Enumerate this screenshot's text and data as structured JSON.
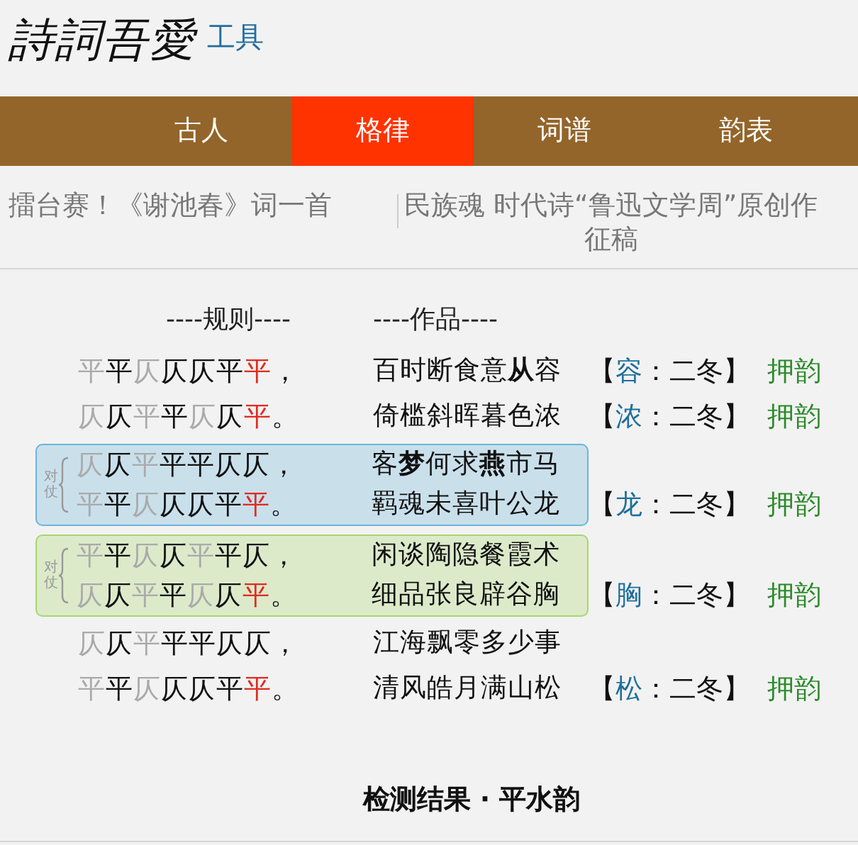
{
  "logo": {
    "title": "詩詞吾愛",
    "subtitle": "工具"
  },
  "nav": [
    {
      "label": "古人",
      "selected": false
    },
    {
      "label": "格律",
      "selected": true
    },
    {
      "label": "词谱",
      "selected": false
    },
    {
      "label": "韵表",
      "selected": false
    }
  ],
  "ticker": [
    {
      "lines": [
        "擂台赛！《谢池春》词一首"
      ]
    },
    {
      "lines": [
        "民族魂 时代诗“鲁迅文学周”原创作",
        "征稿"
      ]
    }
  ],
  "headers": {
    "rules": "----规则----",
    "poem": "----作品----"
  },
  "blocks": [
    {
      "kind": "plain",
      "lines": [
        {
          "rule": [
            {
              "char": "平",
              "kind": "flex"
            },
            {
              "char": "平",
              "kind": "fixed"
            },
            {
              "char": "仄",
              "kind": "flex"
            },
            {
              "char": "仄",
              "kind": "fixed"
            },
            {
              "char": "仄",
              "kind": "fixed"
            },
            {
              "char": "平",
              "kind": "fixed"
            },
            {
              "char": "平",
              "kind": "rhyme"
            },
            {
              "char": "，",
              "kind": "fixed"
            }
          ],
          "poem": "百时断食意**从**容",
          "rhyme": {
            "open": "【",
            "char": "容",
            "rest": "：二冬】"
          },
          "status": "押韵"
        },
        {
          "rule": [
            {
              "char": "仄",
              "kind": "flex"
            },
            {
              "char": "仄",
              "kind": "fixed"
            },
            {
              "char": "平",
              "kind": "flex"
            },
            {
              "char": "平",
              "kind": "fixed"
            },
            {
              "char": "仄",
              "kind": "flex"
            },
            {
              "char": "仄",
              "kind": "fixed"
            },
            {
              "char": "平",
              "kind": "rhyme"
            },
            {
              "char": "。",
              "kind": "fixed"
            }
          ],
          "poem": "倚槛斜晖暮色浓",
          "rhyme": {
            "open": "【",
            "char": "浓",
            "rest": "：二冬】"
          },
          "status": "押韵"
        }
      ]
    },
    {
      "kind": "duizhang",
      "label": "对仗",
      "color": "#6bb5dc",
      "lines": [
        {
          "rule": [
            {
              "char": "仄",
              "kind": "flex"
            },
            {
              "char": "仄",
              "kind": "fixed"
            },
            {
              "char": "平",
              "kind": "flex"
            },
            {
              "char": "平",
              "kind": "fixed"
            },
            {
              "char": "平",
              "kind": "fixed"
            },
            {
              "char": "仄",
              "kind": "fixed"
            },
            {
              "char": "仄",
              "kind": "fixed"
            },
            {
              "char": "，",
              "kind": "fixed"
            }
          ],
          "poem": "客**梦**何求**燕**市马"
        },
        {
          "rule": [
            {
              "char": "平",
              "kind": "flex"
            },
            {
              "char": "平",
              "kind": "fixed"
            },
            {
              "char": "仄",
              "kind": "flex"
            },
            {
              "char": "仄",
              "kind": "fixed"
            },
            {
              "char": "仄",
              "kind": "fixed"
            },
            {
              "char": "平",
              "kind": "fixed"
            },
            {
              "char": "平",
              "kind": "rhyme"
            },
            {
              "char": "。",
              "kind": "fixed"
            }
          ],
          "poem": "羁魂未喜叶公龙",
          "rhyme": {
            "open": "【",
            "char": "龙",
            "rest": "：二冬】"
          },
          "status": "押韵"
        }
      ]
    },
    {
      "kind": "duizhang",
      "label": "对仗",
      "color": "#a8d66e",
      "lines": [
        {
          "rule": [
            {
              "char": "平",
              "kind": "flex"
            },
            {
              "char": "平",
              "kind": "fixed"
            },
            {
              "char": "仄",
              "kind": "flex"
            },
            {
              "char": "仄",
              "kind": "fixed"
            },
            {
              "char": "平",
              "kind": "flex"
            },
            {
              "char": "平",
              "kind": "fixed"
            },
            {
              "char": "仄",
              "kind": "fixed"
            },
            {
              "char": "，",
              "kind": "fixed"
            }
          ],
          "poem": "闲谈陶隐餐霞术"
        },
        {
          "rule": [
            {
              "char": "仄",
              "kind": "flex"
            },
            {
              "char": "仄",
              "kind": "fixed"
            },
            {
              "char": "平",
              "kind": "flex"
            },
            {
              "char": "平",
              "kind": "fixed"
            },
            {
              "char": "仄",
              "kind": "flex"
            },
            {
              "char": "仄",
              "kind": "fixed"
            },
            {
              "char": "平",
              "kind": "rhyme"
            },
            {
              "char": "。",
              "kind": "fixed"
            }
          ],
          "poem": "细品张良辟谷胸",
          "rhyme": {
            "open": "【",
            "char": "胸",
            "rest": "：二冬】"
          },
          "status": "押韵"
        }
      ]
    },
    {
      "kind": "plain",
      "lines": [
        {
          "rule": [
            {
              "char": "仄",
              "kind": "flex"
            },
            {
              "char": "仄",
              "kind": "fixed"
            },
            {
              "char": "平",
              "kind": "flex"
            },
            {
              "char": "平",
              "kind": "fixed"
            },
            {
              "char": "平",
              "kind": "fixed"
            },
            {
              "char": "仄",
              "kind": "fixed"
            },
            {
              "char": "仄",
              "kind": "fixed"
            },
            {
              "char": "，",
              "kind": "fixed"
            }
          ],
          "poem": "江海飘零多少事"
        },
        {
          "rule": [
            {
              "char": "平",
              "kind": "flex"
            },
            {
              "char": "平",
              "kind": "fixed"
            },
            {
              "char": "仄",
              "kind": "flex"
            },
            {
              "char": "仄",
              "kind": "fixed"
            },
            {
              "char": "仄",
              "kind": "fixed"
            },
            {
              "char": "平",
              "kind": "fixed"
            },
            {
              "char": "平",
              "kind": "rhyme"
            },
            {
              "char": "。",
              "kind": "fixed"
            }
          ],
          "poem": "清风皓月满山松",
          "rhyme": {
            "open": "【",
            "char": "松",
            "rest": "：二冬】"
          },
          "status": "押韵"
        }
      ]
    }
  ],
  "result_title": "检测结果 · 平水韵"
}
